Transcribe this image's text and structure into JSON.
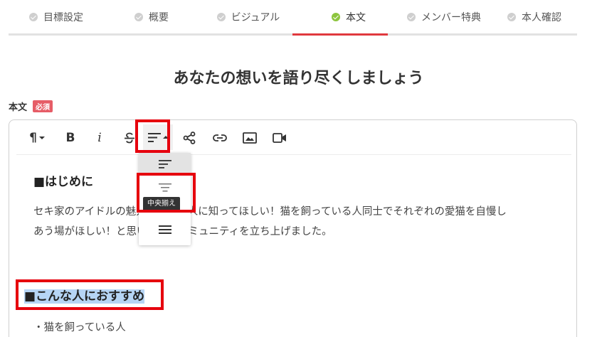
{
  "steps": [
    {
      "label": "目標設定",
      "active": false
    },
    {
      "label": "概要",
      "active": false
    },
    {
      "label": "ビジュアル",
      "active": false
    },
    {
      "label": "本文",
      "active": true
    },
    {
      "label": "メンバー特典",
      "active": false
    },
    {
      "label": "本人確認",
      "active": false
    }
  ],
  "headline": "あなたの想いを語り尽くしましょう",
  "field": {
    "label": "本文",
    "required_badge": "必須"
  },
  "toolbar": {
    "paragraph_icon": "¶",
    "bold_label": "B",
    "italic_label": "i"
  },
  "align_dropdown": {
    "items": [
      "align-left-icon",
      "align-center-icon",
      "align-justify-icon"
    ],
    "tooltip": "中央揃え"
  },
  "content": {
    "heading1": "■はじめに",
    "para1_line1": "セキ家のアイドルの魅力を色んな人に知ってほしい！猫を飼っている人同士でそれぞれの愛猫を自慢し",
    "para1_line2": "あう場がほしい！と思い、このコミュニティを立ち上げました。",
    "heading2": "■こんな人におすすめ",
    "bullet1": "・猫を飼っている人"
  },
  "colors": {
    "accent": "#e0393e",
    "check_active": "#8dc53e",
    "highlight": "#e6000d",
    "selection": "#b6d5f5",
    "badge": "#e65d67"
  }
}
